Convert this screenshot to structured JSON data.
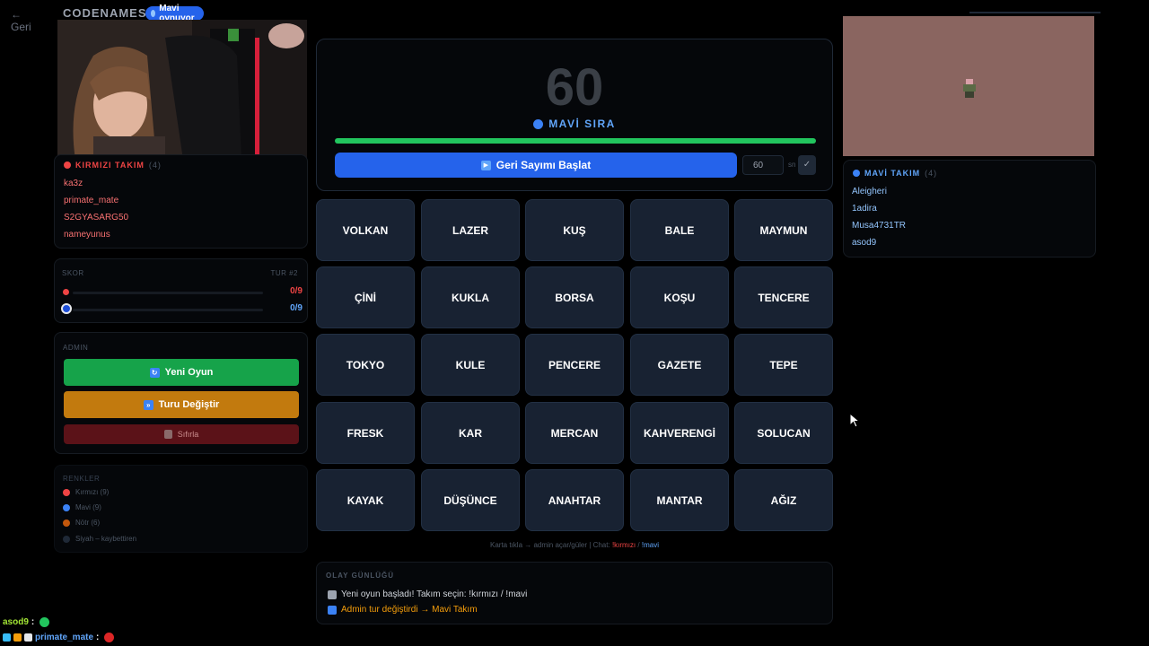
{
  "topbar": {
    "back_label": "← Geri",
    "brand": "CODENAMES",
    "turn_pill": "Mavi oynuyor"
  },
  "colors": {
    "red": "#ef4444",
    "blue": "#3b82f6",
    "green_button": "#16a34a",
    "orange_button": "#c27a0e",
    "danger_button": "#5b1218",
    "card_bg": "#182232"
  },
  "red_team": {
    "title": "KIRMIZI TAKIM",
    "count": "(4)",
    "members": [
      "ka3z",
      "primate_mate",
      "S2GYASARG50",
      "nameyunus"
    ]
  },
  "blue_team": {
    "title": "MAVİ TAKIM",
    "count": "(4)",
    "members": [
      "Aleigheri",
      "1adira",
      "Musa4731TR",
      "asod9"
    ]
  },
  "score": {
    "label": "SKOR",
    "round": "TUR #2",
    "red_value": "0/9",
    "blue_value": "0/9"
  },
  "admin": {
    "label": "ADMIN",
    "new_game": "Yeni Oyun",
    "switch_turn": "Turu Değiştir",
    "reset": "Sıfırla"
  },
  "legend": {
    "label": "RENKLER",
    "items": [
      "Kırmızı (9)",
      "Mavi (9)",
      "Nötr (6)",
      "Siyah – kaybettiren"
    ]
  },
  "timer": {
    "seconds_display": "60",
    "turn_label": "MAVİ SIRA",
    "progress_fraction": 1.0,
    "start_button": "Geri Sayımı Başlat",
    "seconds_input": "60",
    "seconds_unit": "sn",
    "confirm": "✓"
  },
  "board": {
    "words": [
      [
        "VOLKAN",
        "LAZER",
        "KUŞ",
        "BALE",
        "MAYMUN"
      ],
      [
        "ÇİNİ",
        "KUKLA",
        "BORSA",
        "KOŞU",
        "TENCERE"
      ],
      [
        "TOKYO",
        "KULE",
        "PENCERE",
        "GAZETE",
        "TEPE"
      ],
      [
        "FRESK",
        "KAR",
        "MERCAN",
        "KAHVERENGİ",
        "SOLUCAN"
      ],
      [
        "KAYAK",
        "DÜŞÜNCE",
        "ANAHTAR",
        "MANTAR",
        "AĞIZ"
      ]
    ]
  },
  "hint": {
    "text": "Karta tıkla → admin açar/güler  |  Chat:",
    "red_cmd": "!kırmızı",
    "sep": "/",
    "blue_cmd": "!mavi"
  },
  "log": {
    "label": "OLAY GÜNLÜĞÜ",
    "entries": [
      "Yeni oyun başladı! Takım seçin: !kırmızı / !mavi",
      "Admin tur değiştirdi → Mavi Takım"
    ]
  },
  "chat": [
    {
      "user": "asod9",
      "sep": ":"
    },
    {
      "user": "primate_mate",
      "sep": ":"
    }
  ]
}
